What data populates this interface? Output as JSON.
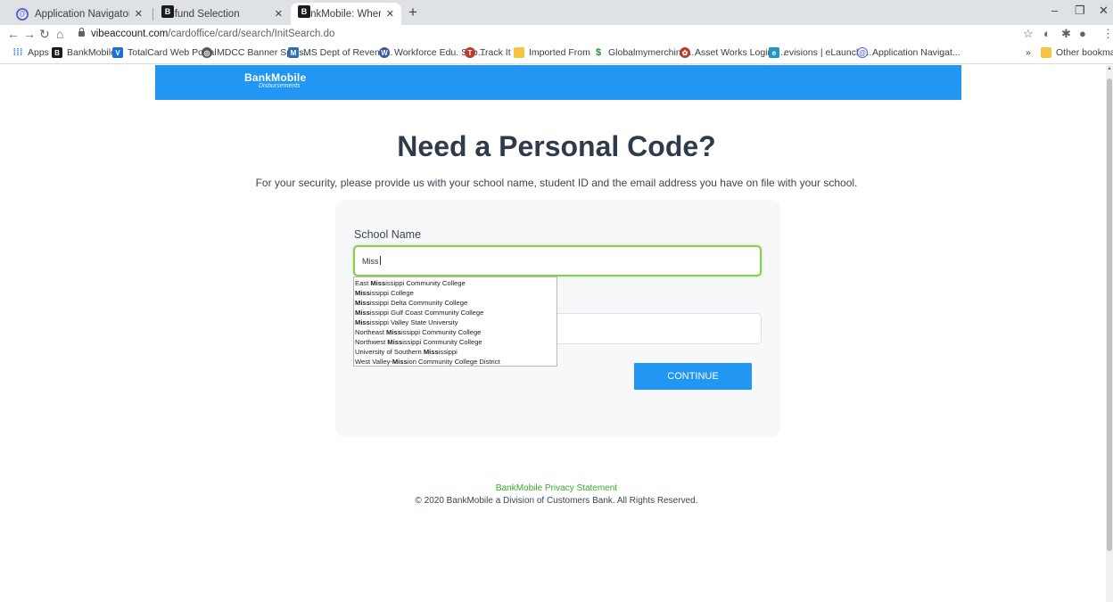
{
  "browser": {
    "tabs": [
      {
        "label": "Application Navigator",
        "favicon": "nav-icon",
        "active": false
      },
      {
        "label": "Refund Selection",
        "favicon": "bankmobile-icon",
        "active": false
      },
      {
        "label": "BankMobile: Where's My Refund",
        "favicon": "bankmobile-icon",
        "active": true
      }
    ],
    "url_host": "vibeaccount.com",
    "url_path": "/cardoffice/card/search/InitSearch.do",
    "bookmarks": [
      {
        "label": "Apps"
      },
      {
        "label": "BankMobile"
      },
      {
        "label": "TotalCard Web Portal"
      },
      {
        "label": "MDCC Banner Splas..."
      },
      {
        "label": "MS Dept of Revenu..."
      },
      {
        "label": "Workforce Edu. Sub..."
      },
      {
        "label": "Track It"
      },
      {
        "label": "Imported From IE"
      },
      {
        "label": "Globalmymerchinfo..."
      },
      {
        "label": "Asset Works Login I..."
      },
      {
        "label": "evisions | eLaunche..."
      },
      {
        "label": "Application Navigat..."
      }
    ],
    "other_bookmarks": "Other bookmarks",
    "overflow": "»"
  },
  "banner": {
    "logo_main": "BankMobile",
    "logo_sub": "Disbursements",
    "color": "#2196f3"
  },
  "page": {
    "title": "Need a Personal Code?",
    "subtitle": "For your security, please provide us with your school name, student ID and the email address you have on file with your school."
  },
  "form": {
    "school_label": "School Name",
    "school_value": "Miss",
    "suggestions": [
      {
        "pre": "East ",
        "match": "Miss",
        "post": "issippi Community College"
      },
      {
        "pre": "",
        "match": "Miss",
        "post": "issippi College"
      },
      {
        "pre": "",
        "match": "Miss",
        "post": "issippi Delta Community College"
      },
      {
        "pre": "",
        "match": "Miss",
        "post": "issippi Gulf Coast Community College"
      },
      {
        "pre": "",
        "match": "Miss",
        "post": "issippi Valley State University"
      },
      {
        "pre": "Northeast ",
        "match": "Miss",
        "post": "issippi Community College"
      },
      {
        "pre": "Northwest ",
        "match": "Miss",
        "post": "issippi Community College"
      },
      {
        "pre": "University of Southern ",
        "match": "Miss",
        "post": "issippi"
      },
      {
        "pre": "West Valley-",
        "match": "Miss",
        "post": "ion Community College District"
      }
    ],
    "continue_label": "CONTINUE"
  },
  "footer": {
    "privacy_link": "BankMobile Privacy Statement",
    "copyright": "© 2020 BankMobile a Division of Customers Bank. All Rights Reserved."
  },
  "colors": {
    "accent": "#2196f3",
    "focus_border": "#8ccc4a",
    "link": "#3aaa2a"
  }
}
